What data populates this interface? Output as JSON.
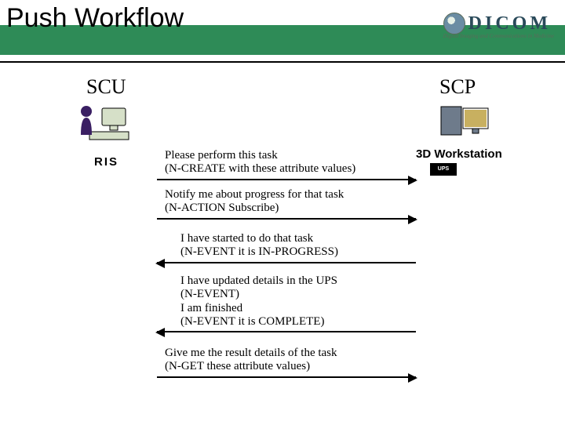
{
  "header": {
    "title": "Push Workflow",
    "logo_text": "DICOM",
    "logo_sub": "Digital Imaging and Communications in Medicine"
  },
  "roles": {
    "scu": "SCU",
    "scp": "SCP",
    "ris_label": "RIS",
    "workstation_label": "3D Workstation",
    "ups": "UPS"
  },
  "messages": {
    "m1": "Please perform this task\n(N-CREATE with these attribute values)",
    "m2": "Notify me about progress for that task\n(N-ACTION Subscribe)",
    "m3": "I have started to do that task\n(N-EVENT it is IN-PROGRESS)",
    "m4": "I have updated details in the UPS\n(N-EVENT)\nI am finished\n(N-EVENT it is COMPLETE)",
    "m5": "Give me the result details of the task\n(N-GET these attribute values)"
  }
}
